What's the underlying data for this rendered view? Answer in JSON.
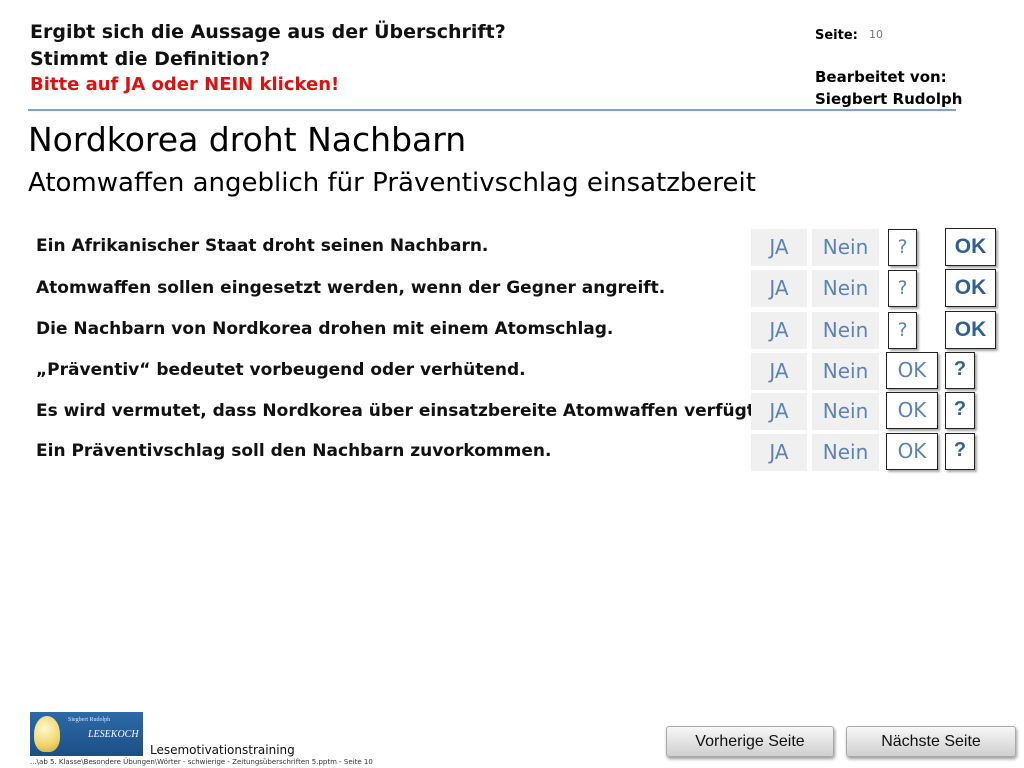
{
  "header": {
    "line1": "Ergibt sich die Aussage aus der Überschrift?",
    "line2": "Stimmt die Definition?",
    "line3": "Bitte auf JA oder NEIN klicken!",
    "seite_label": "Seite:",
    "seite_number": "10",
    "bearbeitet_label": "Bearbeitet von:",
    "author": "Siegbert Rudolph"
  },
  "title": "Nordkorea droht Nachbarn",
  "subtitle": "Atomwaffen angeblich für Präventivschlag einsatzbereit",
  "statements": [
    {
      "text": "Ein Afrikanischer Staat droht seinen Nachbarn.",
      "ja": "JA",
      "nein": "Nein",
      "box1": "?",
      "box2": "OK"
    },
    {
      "text": "Atomwaffen sollen eingesetzt werden, wenn der Gegner angreift.",
      "ja": "JA",
      "nein": "Nein",
      "box1": "?",
      "box2": "OK"
    },
    {
      "text": "Die Nachbarn von Nordkorea drohen mit einem Atomschlag.",
      "ja": "JA",
      "nein": "Nein",
      "box1": "?",
      "box2": "OK"
    },
    {
      "text": "„Präventiv“ bedeutet vorbeugend oder verhütend.",
      "ja": "JA",
      "nein": "Nein",
      "box1": "OK",
      "box2": "?"
    },
    {
      "text": "Es wird vermutet, dass Nordkorea über einsatzbereite Atomwaffen verfügt.",
      "ja": "JA",
      "nein": "Nein",
      "box1": "OK",
      "box2": "?"
    },
    {
      "text": "Ein Präventivschlag soll den Nachbarn zuvorkommen.",
      "ja": "JA",
      "nein": "Nein",
      "box1": "OK",
      "box2": "?"
    }
  ],
  "footer": {
    "logo_small": "Siegbert Rudolph",
    "logo_main": "LESEKOCH",
    "training": "Lesemotivationstraining",
    "path": "...\\ab 5. Klasse\\Besondere Übungen\\Wörter - schwierige - Zeitungsüberschriften 5.pptm - Seite 10",
    "prev": "Vorherige Seite",
    "next": "Nächste Seite"
  },
  "colors": {
    "accent_blue": "#5b83b8",
    "instruction_red": "#e01010",
    "rule_blue": "#7fa3c9"
  }
}
